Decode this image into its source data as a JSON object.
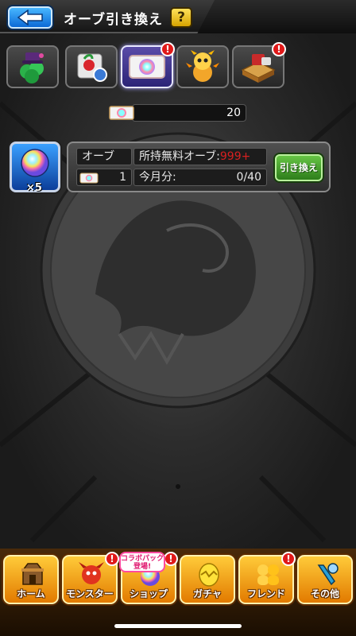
{
  "header": {
    "title": "オーブ引き換え",
    "help_label": "?",
    "back_icon": "back-arrow-icon"
  },
  "tabs": [
    {
      "name": "monster-tab",
      "icon": "clover-hat-icon",
      "badge": ""
    },
    {
      "name": "gift-tab",
      "icon": "gift-card-icon",
      "badge": ""
    },
    {
      "name": "orb-ticket-tab",
      "icon": "orb-ticket-icon",
      "badge": "!",
      "active": true
    },
    {
      "name": "character-tab",
      "icon": "dragon-character-icon",
      "badge": ""
    },
    {
      "name": "item-tab",
      "icon": "treasure-box-icon",
      "badge": "!"
    }
  ],
  "ticket": {
    "count": "20",
    "icon": "orb-ticket-icon"
  },
  "orb_item": {
    "quantity_label": "×5",
    "icon": "rainbow-orb-icon"
  },
  "info": {
    "item_name": "オーブ",
    "owned_free_label": "所持無料オーブ:",
    "owned_free_value": "999+",
    "cost_value": "1",
    "monthly_label": "今月分:",
    "monthly_value": "0/40"
  },
  "exchange_button": "引き換え",
  "bottom_nav": [
    {
      "label": "ホーム",
      "icon": "castle-icon",
      "badge": ""
    },
    {
      "label": "モンスター",
      "icon": "red-dragon-icon",
      "badge": "!"
    },
    {
      "label": "ショップ",
      "icon": "rainbow-orb-icon",
      "badge": "!"
    },
    {
      "label": "ガチャ",
      "icon": "egg-icon",
      "badge": ""
    },
    {
      "label": "フレンド",
      "icon": "friends-icon",
      "badge": "!"
    },
    {
      "label": "その他",
      "icon": "tools-icon",
      "badge": ""
    }
  ],
  "promo_badge": {
    "line1": "コラボパック",
    "line2": "登場!"
  },
  "colors": {
    "accent_blue": "#0b69d6",
    "exchange_green": "#2e7d1b",
    "nav_orange": "#e27a00",
    "alert_red": "#e01919"
  }
}
